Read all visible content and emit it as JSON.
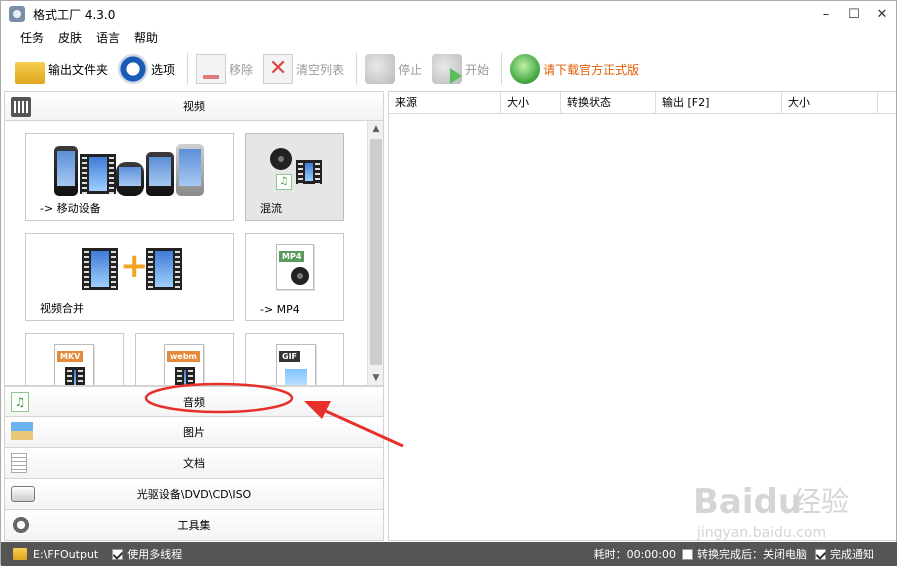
{
  "app": {
    "title": "格式工厂 4.3.0"
  },
  "menu": [
    "任务",
    "皮肤",
    "语言",
    "帮助"
  ],
  "toolbar": {
    "output_folder": "输出文件夹",
    "options": "选项",
    "remove": "移除",
    "clear_list": "清空列表",
    "stop": "停止",
    "start": "开始",
    "download": "请下载官方正式版"
  },
  "categories": {
    "video": "视频",
    "audio": "音频",
    "picture": "图片",
    "document": "文档",
    "disc": "光驱设备\\DVD\\CD\\ISO",
    "tools": "工具集"
  },
  "tiles": {
    "mobile": "-> 移动设备",
    "mux": "混流",
    "merge": "视频合并",
    "mp4": "-> MP4",
    "mkv_badge": "MKV",
    "webm_badge": "webm",
    "gif_badge": "GIF",
    "mp4_badge": "MP4"
  },
  "table": {
    "columns": [
      "来源",
      "大小",
      "转换状态",
      "输出 [F2]",
      "大小"
    ]
  },
  "status": {
    "output_path": "E:\\FFOutput",
    "multithread": "使用多线程",
    "elapsed": "耗时：00:00:00",
    "after_done": "转换完成后：关闭电脑",
    "notify": "完成通知"
  },
  "watermark": {
    "brand": "Baidu",
    "brand_cn": "经验",
    "url": "jingyan.baidu.com"
  },
  "colors": {
    "status_bg": "#555555",
    "download_text": "#e15a00",
    "annotation": "#e8302a"
  }
}
